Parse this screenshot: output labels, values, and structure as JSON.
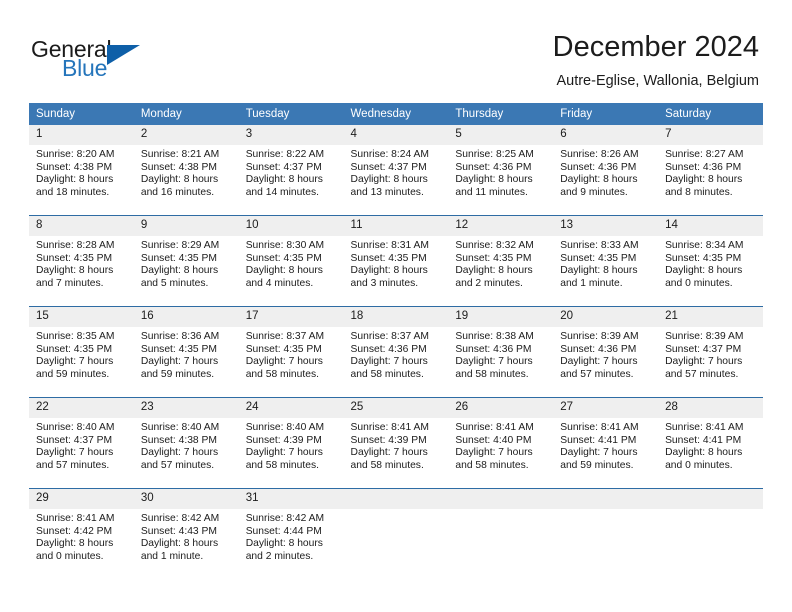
{
  "logo": {
    "word_one": "General",
    "word_two": "Blue",
    "mark": "triangle-mark"
  },
  "header": {
    "month_title": "December 2024",
    "location": "Autre-Eglise, Wallonia, Belgium"
  },
  "colors": {
    "header_blue": "#3b78b4",
    "row_divider_blue": "#2e6ca4",
    "daynum_band": "#efefef",
    "logo_blue": "#2575bb",
    "logo_triangle": "#0e5fa8",
    "text": "#1c1c1c"
  },
  "weekday_headers": [
    "Sunday",
    "Monday",
    "Tuesday",
    "Wednesday",
    "Thursday",
    "Friday",
    "Saturday"
  ],
  "weeks": [
    [
      {
        "day": "1",
        "sunrise": "Sunrise: 8:20 AM",
        "sunset": "Sunset: 4:38 PM",
        "daylight_1": "Daylight: 8 hours",
        "daylight_2": "and 18 minutes."
      },
      {
        "day": "2",
        "sunrise": "Sunrise: 8:21 AM",
        "sunset": "Sunset: 4:38 PM",
        "daylight_1": "Daylight: 8 hours",
        "daylight_2": "and 16 minutes."
      },
      {
        "day": "3",
        "sunrise": "Sunrise: 8:22 AM",
        "sunset": "Sunset: 4:37 PM",
        "daylight_1": "Daylight: 8 hours",
        "daylight_2": "and 14 minutes."
      },
      {
        "day": "4",
        "sunrise": "Sunrise: 8:24 AM",
        "sunset": "Sunset: 4:37 PM",
        "daylight_1": "Daylight: 8 hours",
        "daylight_2": "and 13 minutes."
      },
      {
        "day": "5",
        "sunrise": "Sunrise: 8:25 AM",
        "sunset": "Sunset: 4:36 PM",
        "daylight_1": "Daylight: 8 hours",
        "daylight_2": "and 11 minutes."
      },
      {
        "day": "6",
        "sunrise": "Sunrise: 8:26 AM",
        "sunset": "Sunset: 4:36 PM",
        "daylight_1": "Daylight: 8 hours",
        "daylight_2": "and 9 minutes."
      },
      {
        "day": "7",
        "sunrise": "Sunrise: 8:27 AM",
        "sunset": "Sunset: 4:36 PM",
        "daylight_1": "Daylight: 8 hours",
        "daylight_2": "and 8 minutes."
      }
    ],
    [
      {
        "day": "8",
        "sunrise": "Sunrise: 8:28 AM",
        "sunset": "Sunset: 4:35 PM",
        "daylight_1": "Daylight: 8 hours",
        "daylight_2": "and 7 minutes."
      },
      {
        "day": "9",
        "sunrise": "Sunrise: 8:29 AM",
        "sunset": "Sunset: 4:35 PM",
        "daylight_1": "Daylight: 8 hours",
        "daylight_2": "and 5 minutes."
      },
      {
        "day": "10",
        "sunrise": "Sunrise: 8:30 AM",
        "sunset": "Sunset: 4:35 PM",
        "daylight_1": "Daylight: 8 hours",
        "daylight_2": "and 4 minutes."
      },
      {
        "day": "11",
        "sunrise": "Sunrise: 8:31 AM",
        "sunset": "Sunset: 4:35 PM",
        "daylight_1": "Daylight: 8 hours",
        "daylight_2": "and 3 minutes."
      },
      {
        "day": "12",
        "sunrise": "Sunrise: 8:32 AM",
        "sunset": "Sunset: 4:35 PM",
        "daylight_1": "Daylight: 8 hours",
        "daylight_2": "and 2 minutes."
      },
      {
        "day": "13",
        "sunrise": "Sunrise: 8:33 AM",
        "sunset": "Sunset: 4:35 PM",
        "daylight_1": "Daylight: 8 hours",
        "daylight_2": "and 1 minute."
      },
      {
        "day": "14",
        "sunrise": "Sunrise: 8:34 AM",
        "sunset": "Sunset: 4:35 PM",
        "daylight_1": "Daylight: 8 hours",
        "daylight_2": "and 0 minutes."
      }
    ],
    [
      {
        "day": "15",
        "sunrise": "Sunrise: 8:35 AM",
        "sunset": "Sunset: 4:35 PM",
        "daylight_1": "Daylight: 7 hours",
        "daylight_2": "and 59 minutes."
      },
      {
        "day": "16",
        "sunrise": "Sunrise: 8:36 AM",
        "sunset": "Sunset: 4:35 PM",
        "daylight_1": "Daylight: 7 hours",
        "daylight_2": "and 59 minutes."
      },
      {
        "day": "17",
        "sunrise": "Sunrise: 8:37 AM",
        "sunset": "Sunset: 4:35 PM",
        "daylight_1": "Daylight: 7 hours",
        "daylight_2": "and 58 minutes."
      },
      {
        "day": "18",
        "sunrise": "Sunrise: 8:37 AM",
        "sunset": "Sunset: 4:36 PM",
        "daylight_1": "Daylight: 7 hours",
        "daylight_2": "and 58 minutes."
      },
      {
        "day": "19",
        "sunrise": "Sunrise: 8:38 AM",
        "sunset": "Sunset: 4:36 PM",
        "daylight_1": "Daylight: 7 hours",
        "daylight_2": "and 58 minutes."
      },
      {
        "day": "20",
        "sunrise": "Sunrise: 8:39 AM",
        "sunset": "Sunset: 4:36 PM",
        "daylight_1": "Daylight: 7 hours",
        "daylight_2": "and 57 minutes."
      },
      {
        "day": "21",
        "sunrise": "Sunrise: 8:39 AM",
        "sunset": "Sunset: 4:37 PM",
        "daylight_1": "Daylight: 7 hours",
        "daylight_2": "and 57 minutes."
      }
    ],
    [
      {
        "day": "22",
        "sunrise": "Sunrise: 8:40 AM",
        "sunset": "Sunset: 4:37 PM",
        "daylight_1": "Daylight: 7 hours",
        "daylight_2": "and 57 minutes."
      },
      {
        "day": "23",
        "sunrise": "Sunrise: 8:40 AM",
        "sunset": "Sunset: 4:38 PM",
        "daylight_1": "Daylight: 7 hours",
        "daylight_2": "and 57 minutes."
      },
      {
        "day": "24",
        "sunrise": "Sunrise: 8:40 AM",
        "sunset": "Sunset: 4:39 PM",
        "daylight_1": "Daylight: 7 hours",
        "daylight_2": "and 58 minutes."
      },
      {
        "day": "25",
        "sunrise": "Sunrise: 8:41 AM",
        "sunset": "Sunset: 4:39 PM",
        "daylight_1": "Daylight: 7 hours",
        "daylight_2": "and 58 minutes."
      },
      {
        "day": "26",
        "sunrise": "Sunrise: 8:41 AM",
        "sunset": "Sunset: 4:40 PM",
        "daylight_1": "Daylight: 7 hours",
        "daylight_2": "and 58 minutes."
      },
      {
        "day": "27",
        "sunrise": "Sunrise: 8:41 AM",
        "sunset": "Sunset: 4:41 PM",
        "daylight_1": "Daylight: 7 hours",
        "daylight_2": "and 59 minutes."
      },
      {
        "day": "28",
        "sunrise": "Sunrise: 8:41 AM",
        "sunset": "Sunset: 4:41 PM",
        "daylight_1": "Daylight: 8 hours",
        "daylight_2": "and 0 minutes."
      }
    ],
    [
      {
        "day": "29",
        "sunrise": "Sunrise: 8:41 AM",
        "sunset": "Sunset: 4:42 PM",
        "daylight_1": "Daylight: 8 hours",
        "daylight_2": "and 0 minutes."
      },
      {
        "day": "30",
        "sunrise": "Sunrise: 8:42 AM",
        "sunset": "Sunset: 4:43 PM",
        "daylight_1": "Daylight: 8 hours",
        "daylight_2": "and 1 minute."
      },
      {
        "day": "31",
        "sunrise": "Sunrise: 8:42 AM",
        "sunset": "Sunset: 4:44 PM",
        "daylight_1": "Daylight: 8 hours",
        "daylight_2": "and 2 minutes."
      },
      {
        "day": "",
        "sunrise": "",
        "sunset": "",
        "daylight_1": "",
        "daylight_2": ""
      },
      {
        "day": "",
        "sunrise": "",
        "sunset": "",
        "daylight_1": "",
        "daylight_2": ""
      },
      {
        "day": "",
        "sunrise": "",
        "sunset": "",
        "daylight_1": "",
        "daylight_2": ""
      },
      {
        "day": "",
        "sunrise": "",
        "sunset": "",
        "daylight_1": "",
        "daylight_2": ""
      }
    ]
  ]
}
